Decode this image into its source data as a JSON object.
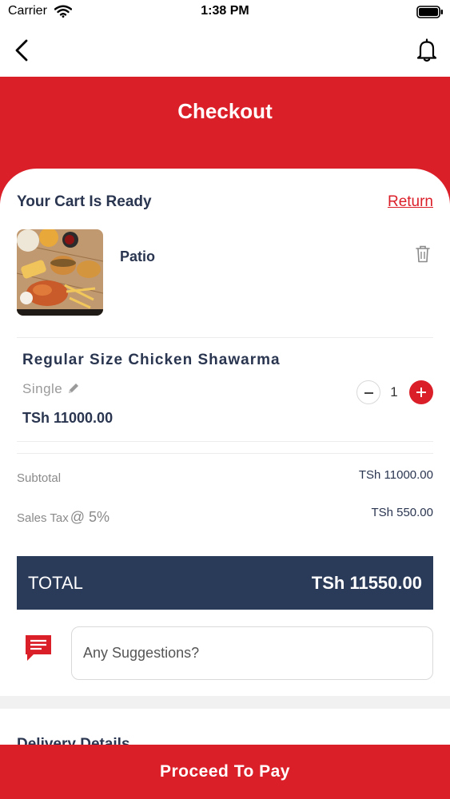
{
  "status_bar": {
    "carrier": "Carrier",
    "time": "1:38 PM"
  },
  "header": {
    "title": "Checkout"
  },
  "cart": {
    "title": "Your Cart Is Ready",
    "return_label": "Return",
    "restaurant_name": "Patio",
    "item": {
      "name": "Regular Size Chicken Shawarma",
      "variant": "Single",
      "price": "TSh 11000.00",
      "quantity": "1"
    }
  },
  "summary": {
    "subtotal_label": "Subtotal",
    "subtotal_value": "TSh 11000.00",
    "tax_label": "Sales Tax",
    "tax_rate": "@ 5%",
    "tax_value": "TSh 550.00",
    "total_label": "TOTAL",
    "total_value": "TSh 11550.00"
  },
  "suggestions": {
    "placeholder": "Any Suggestions?"
  },
  "delivery": {
    "heading": "Delivery Details"
  },
  "footer": {
    "proceed_label": "Proceed To Pay"
  },
  "colors": {
    "brand_red": "#db1f29",
    "navy": "#2a3a59",
    "text_dark": "#2a3550"
  },
  "icons": [
    "back-icon",
    "bell-icon",
    "trash-icon",
    "edit-icon",
    "minus-icon",
    "plus-icon",
    "chat-icon"
  ]
}
